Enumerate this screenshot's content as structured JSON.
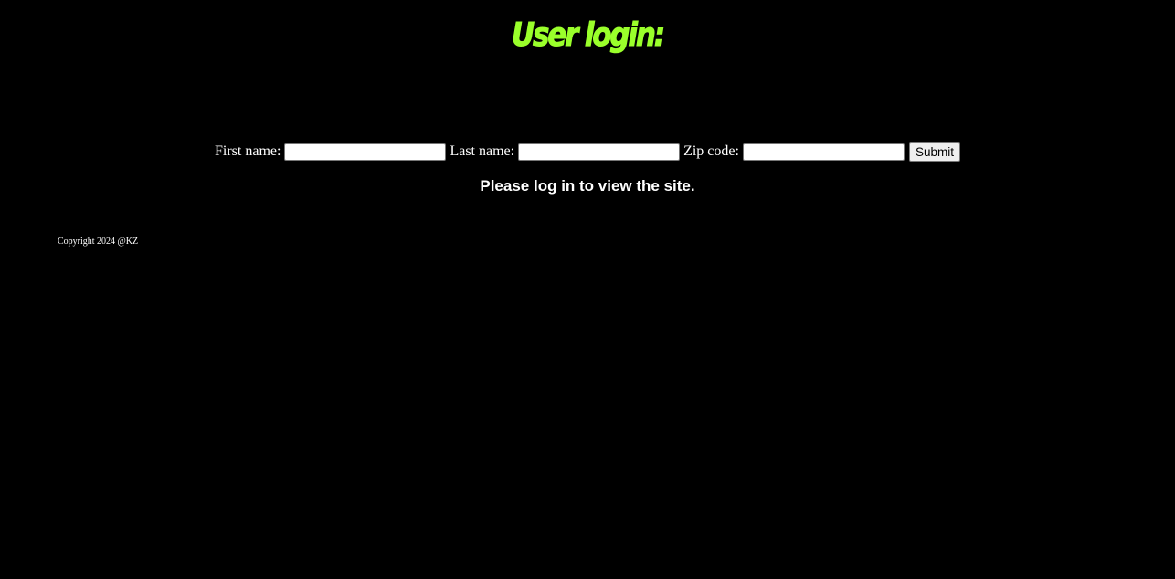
{
  "page": {
    "title": "User login:",
    "background_color": "#000000",
    "accent_color": "#9aff2b"
  },
  "form": {
    "first_name_label": "First name:",
    "first_name_value": "",
    "last_name_label": "Last name:",
    "last_name_value": "",
    "zip_code_label": "Zip code:",
    "zip_code_value": "",
    "submit_label": "Submit"
  },
  "message": "Please log in to view the site.",
  "footer": {
    "copyright": "Copyright 2024 @KZ"
  }
}
